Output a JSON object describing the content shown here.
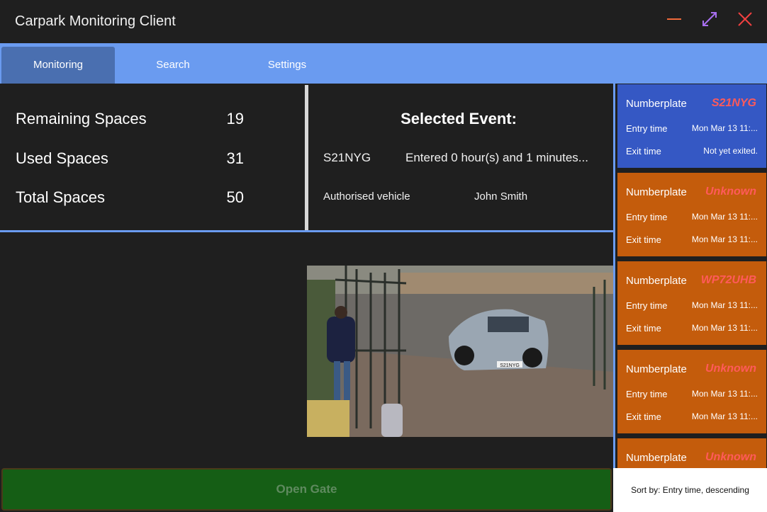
{
  "window": {
    "title": "Carpark Monitoring Client"
  },
  "tabs": [
    {
      "label": "Monitoring",
      "active": true
    },
    {
      "label": "Search"
    },
    {
      "label": "Settings"
    }
  ],
  "stats": [
    {
      "label": "Remaining Spaces",
      "value": "19"
    },
    {
      "label": "Used Spaces",
      "value": "31"
    },
    {
      "label": "Total Spaces",
      "value": "50"
    }
  ],
  "selected_event": {
    "title": "Selected Event:",
    "plate": "S21NYG",
    "duration": "Entered 0 hour(s) and 1 minutes...",
    "status": "Authorised vehicle",
    "owner": "John Smith"
  },
  "events": [
    {
      "plate_label": "Numberplate",
      "plate": "S21NYG",
      "entry_label": "Entry time",
      "entry": "Mon Mar 13 11:...",
      "exit_label": "Exit time",
      "exit": "Not yet exited.",
      "color": "#3558c4"
    },
    {
      "plate_label": "Numberplate",
      "plate": "Unknown",
      "entry_label": "Entry time",
      "entry": "Mon Mar 13 11:...",
      "exit_label": "Exit time",
      "exit": "Mon Mar 13 11:...",
      "color": "#c45c0c"
    },
    {
      "plate_label": "Numberplate",
      "plate": "WP72UHB",
      "entry_label": "Entry time",
      "entry": "Mon Mar 13 11:...",
      "exit_label": "Exit time",
      "exit": "Mon Mar 13 11:...",
      "color": "#c45c0c"
    },
    {
      "plate_label": "Numberplate",
      "plate": "Unknown",
      "entry_label": "Entry time",
      "entry": "Mon Mar 13 11:...",
      "exit_label": "Exit time",
      "exit": "Mon Mar 13 11:...",
      "color": "#c45c0c"
    },
    {
      "plate_label": "Numberplate",
      "plate": "Unknown",
      "entry_label": "Entry time",
      "entry": "",
      "exit_label": "",
      "exit": "",
      "color": "#c45c0c"
    }
  ],
  "camera": {
    "plate_text": "S21NYG"
  },
  "gate_button": {
    "label": "Open Gate"
  },
  "sort": {
    "label": "Sort by: Entry time, descending"
  },
  "icons": {
    "minimize": "minimize-icon",
    "maximize": "maximize-icon",
    "close": "close-icon"
  }
}
